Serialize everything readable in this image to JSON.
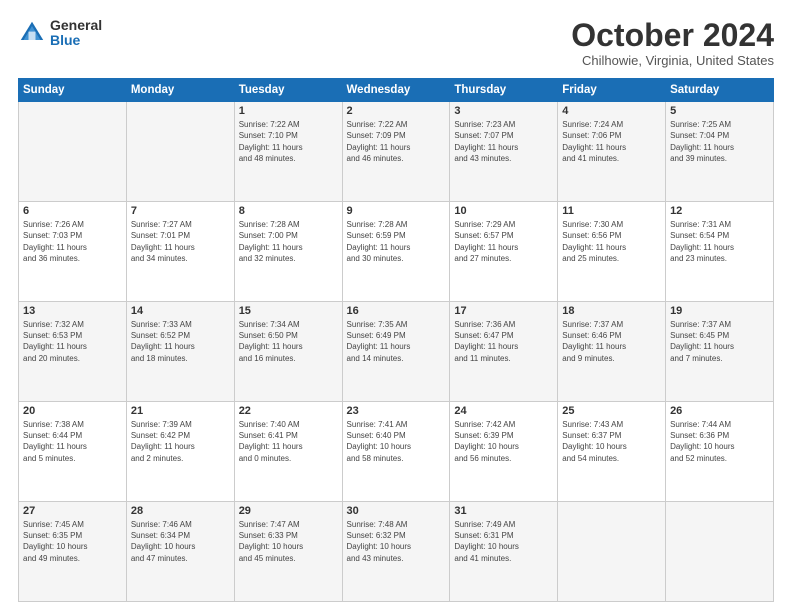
{
  "logo": {
    "general": "General",
    "blue": "Blue"
  },
  "title": "October 2024",
  "location": "Chilhowie, Virginia, United States",
  "days_of_week": [
    "Sunday",
    "Monday",
    "Tuesday",
    "Wednesday",
    "Thursday",
    "Friday",
    "Saturday"
  ],
  "weeks": [
    [
      {
        "day": "",
        "info": ""
      },
      {
        "day": "",
        "info": ""
      },
      {
        "day": "1",
        "info": "Sunrise: 7:22 AM\nSunset: 7:10 PM\nDaylight: 11 hours\nand 48 minutes."
      },
      {
        "day": "2",
        "info": "Sunrise: 7:22 AM\nSunset: 7:09 PM\nDaylight: 11 hours\nand 46 minutes."
      },
      {
        "day": "3",
        "info": "Sunrise: 7:23 AM\nSunset: 7:07 PM\nDaylight: 11 hours\nand 43 minutes."
      },
      {
        "day": "4",
        "info": "Sunrise: 7:24 AM\nSunset: 7:06 PM\nDaylight: 11 hours\nand 41 minutes."
      },
      {
        "day": "5",
        "info": "Sunrise: 7:25 AM\nSunset: 7:04 PM\nDaylight: 11 hours\nand 39 minutes."
      }
    ],
    [
      {
        "day": "6",
        "info": "Sunrise: 7:26 AM\nSunset: 7:03 PM\nDaylight: 11 hours\nand 36 minutes."
      },
      {
        "day": "7",
        "info": "Sunrise: 7:27 AM\nSunset: 7:01 PM\nDaylight: 11 hours\nand 34 minutes."
      },
      {
        "day": "8",
        "info": "Sunrise: 7:28 AM\nSunset: 7:00 PM\nDaylight: 11 hours\nand 32 minutes."
      },
      {
        "day": "9",
        "info": "Sunrise: 7:28 AM\nSunset: 6:59 PM\nDaylight: 11 hours\nand 30 minutes."
      },
      {
        "day": "10",
        "info": "Sunrise: 7:29 AM\nSunset: 6:57 PM\nDaylight: 11 hours\nand 27 minutes."
      },
      {
        "day": "11",
        "info": "Sunrise: 7:30 AM\nSunset: 6:56 PM\nDaylight: 11 hours\nand 25 minutes."
      },
      {
        "day": "12",
        "info": "Sunrise: 7:31 AM\nSunset: 6:54 PM\nDaylight: 11 hours\nand 23 minutes."
      }
    ],
    [
      {
        "day": "13",
        "info": "Sunrise: 7:32 AM\nSunset: 6:53 PM\nDaylight: 11 hours\nand 20 minutes."
      },
      {
        "day": "14",
        "info": "Sunrise: 7:33 AM\nSunset: 6:52 PM\nDaylight: 11 hours\nand 18 minutes."
      },
      {
        "day": "15",
        "info": "Sunrise: 7:34 AM\nSunset: 6:50 PM\nDaylight: 11 hours\nand 16 minutes."
      },
      {
        "day": "16",
        "info": "Sunrise: 7:35 AM\nSunset: 6:49 PM\nDaylight: 11 hours\nand 14 minutes."
      },
      {
        "day": "17",
        "info": "Sunrise: 7:36 AM\nSunset: 6:47 PM\nDaylight: 11 hours\nand 11 minutes."
      },
      {
        "day": "18",
        "info": "Sunrise: 7:37 AM\nSunset: 6:46 PM\nDaylight: 11 hours\nand 9 minutes."
      },
      {
        "day": "19",
        "info": "Sunrise: 7:37 AM\nSunset: 6:45 PM\nDaylight: 11 hours\nand 7 minutes."
      }
    ],
    [
      {
        "day": "20",
        "info": "Sunrise: 7:38 AM\nSunset: 6:44 PM\nDaylight: 11 hours\nand 5 minutes."
      },
      {
        "day": "21",
        "info": "Sunrise: 7:39 AM\nSunset: 6:42 PM\nDaylight: 11 hours\nand 2 minutes."
      },
      {
        "day": "22",
        "info": "Sunrise: 7:40 AM\nSunset: 6:41 PM\nDaylight: 11 hours\nand 0 minutes."
      },
      {
        "day": "23",
        "info": "Sunrise: 7:41 AM\nSunset: 6:40 PM\nDaylight: 10 hours\nand 58 minutes."
      },
      {
        "day": "24",
        "info": "Sunrise: 7:42 AM\nSunset: 6:39 PM\nDaylight: 10 hours\nand 56 minutes."
      },
      {
        "day": "25",
        "info": "Sunrise: 7:43 AM\nSunset: 6:37 PM\nDaylight: 10 hours\nand 54 minutes."
      },
      {
        "day": "26",
        "info": "Sunrise: 7:44 AM\nSunset: 6:36 PM\nDaylight: 10 hours\nand 52 minutes."
      }
    ],
    [
      {
        "day": "27",
        "info": "Sunrise: 7:45 AM\nSunset: 6:35 PM\nDaylight: 10 hours\nand 49 minutes."
      },
      {
        "day": "28",
        "info": "Sunrise: 7:46 AM\nSunset: 6:34 PM\nDaylight: 10 hours\nand 47 minutes."
      },
      {
        "day": "29",
        "info": "Sunrise: 7:47 AM\nSunset: 6:33 PM\nDaylight: 10 hours\nand 45 minutes."
      },
      {
        "day": "30",
        "info": "Sunrise: 7:48 AM\nSunset: 6:32 PM\nDaylight: 10 hours\nand 43 minutes."
      },
      {
        "day": "31",
        "info": "Sunrise: 7:49 AM\nSunset: 6:31 PM\nDaylight: 10 hours\nand 41 minutes."
      },
      {
        "day": "",
        "info": ""
      },
      {
        "day": "",
        "info": ""
      }
    ]
  ]
}
